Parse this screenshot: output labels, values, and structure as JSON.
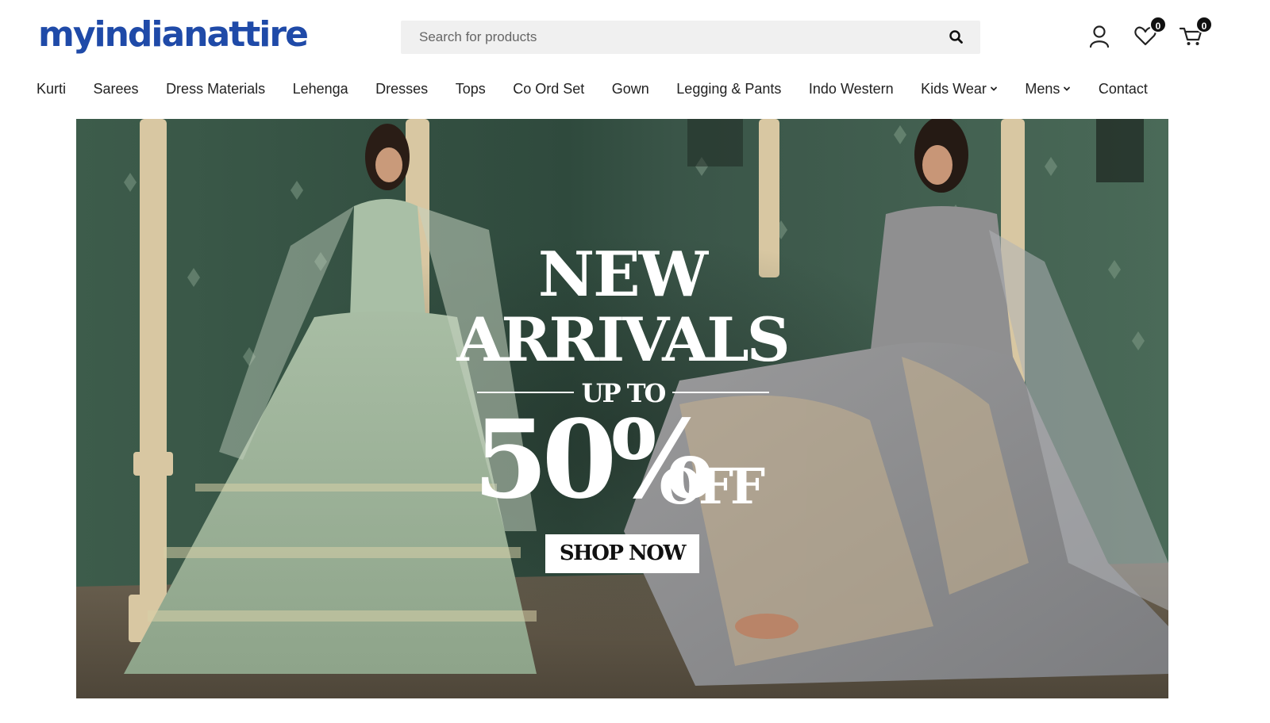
{
  "brand": {
    "logo_text": "myindianattire",
    "color": "#1f4aa8"
  },
  "search": {
    "placeholder": "Search for products",
    "value": "",
    "icon": "search-icon"
  },
  "header_actions": {
    "account_icon": "user-icon",
    "wishlist_icon": "heart-icon",
    "wishlist_count": "0",
    "cart_icon": "cart-icon",
    "cart_count": "0"
  },
  "nav": {
    "items": [
      {
        "label": "Kurti"
      },
      {
        "label": "Sarees"
      },
      {
        "label": "Dress Materials"
      },
      {
        "label": "Lehenga"
      },
      {
        "label": "Dresses"
      },
      {
        "label": "Tops"
      },
      {
        "label": "Co Ord Set"
      },
      {
        "label": "Gown"
      },
      {
        "label": "Legging & Pants"
      },
      {
        "label": "Indo Western"
      },
      {
        "label": "Kids Wear",
        "dropdown": true
      },
      {
        "label": "Mens",
        "dropdown": true
      },
      {
        "label": "Contact"
      }
    ]
  },
  "hero": {
    "line1": "NEW",
    "line2": "ARRIVALS",
    "line3": "UP TO",
    "line4": "50%",
    "line5": "OFF",
    "cta": "SHOP NOW",
    "colors": {
      "wall": "#3b5a4a",
      "left_outfit": "#9cb39a",
      "right_outfit": "#8a8a8c"
    }
  }
}
